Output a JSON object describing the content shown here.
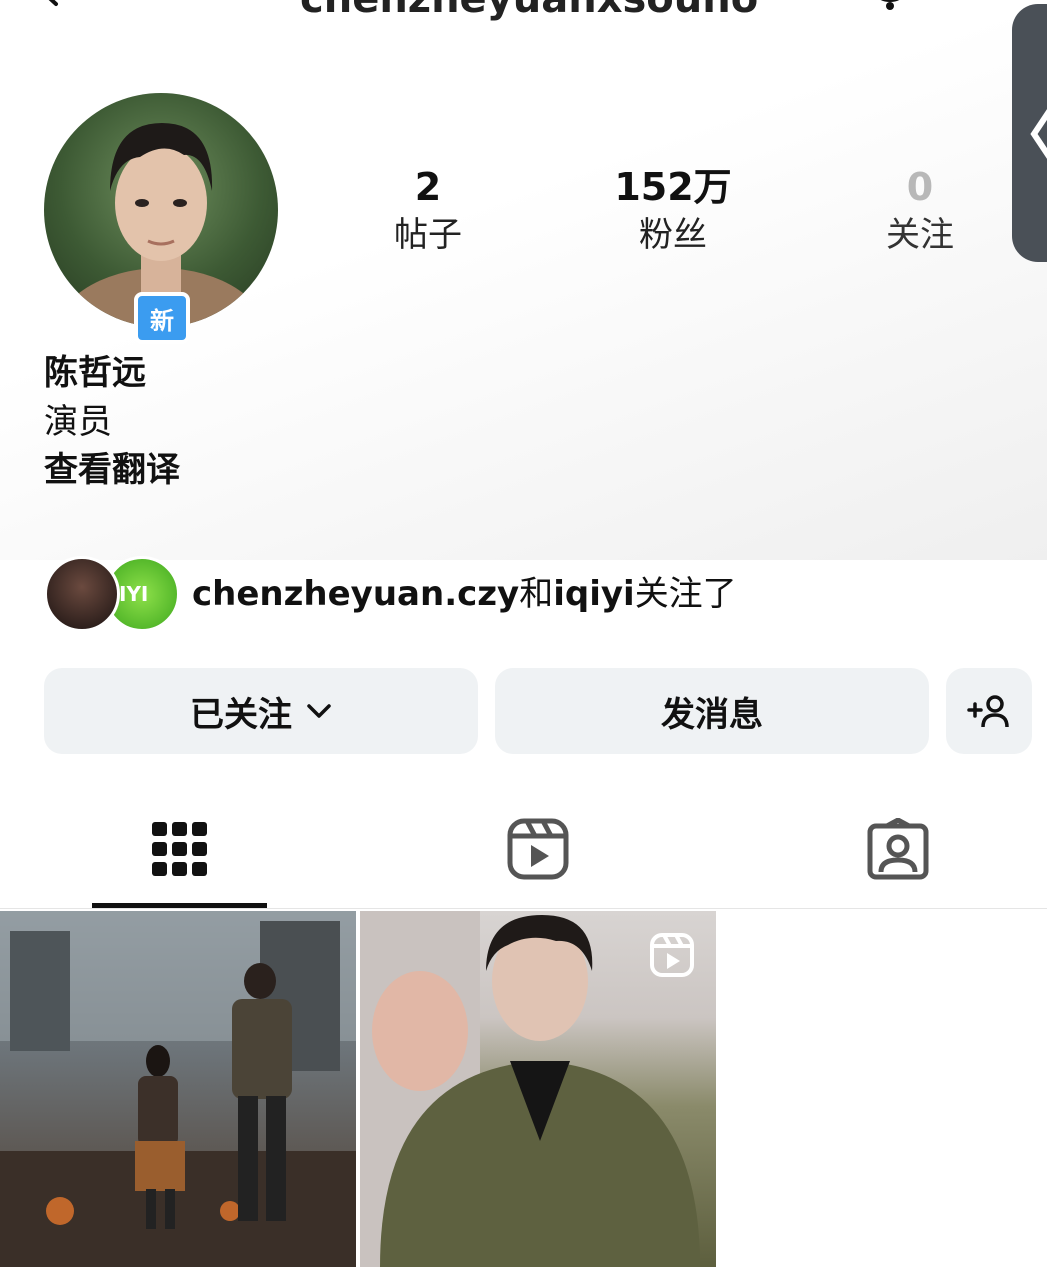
{
  "header": {
    "username_partial": "chenzheyuanxsouno"
  },
  "profile": {
    "avatar_badge": "新",
    "display_name": "陈哲远",
    "bio": "演员",
    "translate_link": "查看翻译"
  },
  "stats": {
    "posts": {
      "value": "2",
      "label": "帖子"
    },
    "followers": {
      "value": "152万",
      "label": "粉丝"
    },
    "following": {
      "value": "0",
      "label": "关注"
    }
  },
  "followed_by": {
    "user1": "chenzheyuan.czy",
    "conjunction": "和",
    "user2": "iqiyi",
    "suffix": "关注了",
    "avatar2_text": "IYI"
  },
  "actions": {
    "following_label": "已关注",
    "message_label": "发消息"
  },
  "tabs": [
    {
      "icon": "grid-icon",
      "active": true
    },
    {
      "icon": "reels-icon",
      "active": false
    },
    {
      "icon": "tagged-icon",
      "active": false
    }
  ],
  "posts": [
    {
      "type": "image"
    },
    {
      "type": "reel",
      "icon": "reel-badge-icon"
    }
  ],
  "colors": {
    "badge_blue": "#3b9cf0",
    "button_bg": "#eff2f4",
    "text": "#111111",
    "muted_count": "#b8b8b8"
  }
}
